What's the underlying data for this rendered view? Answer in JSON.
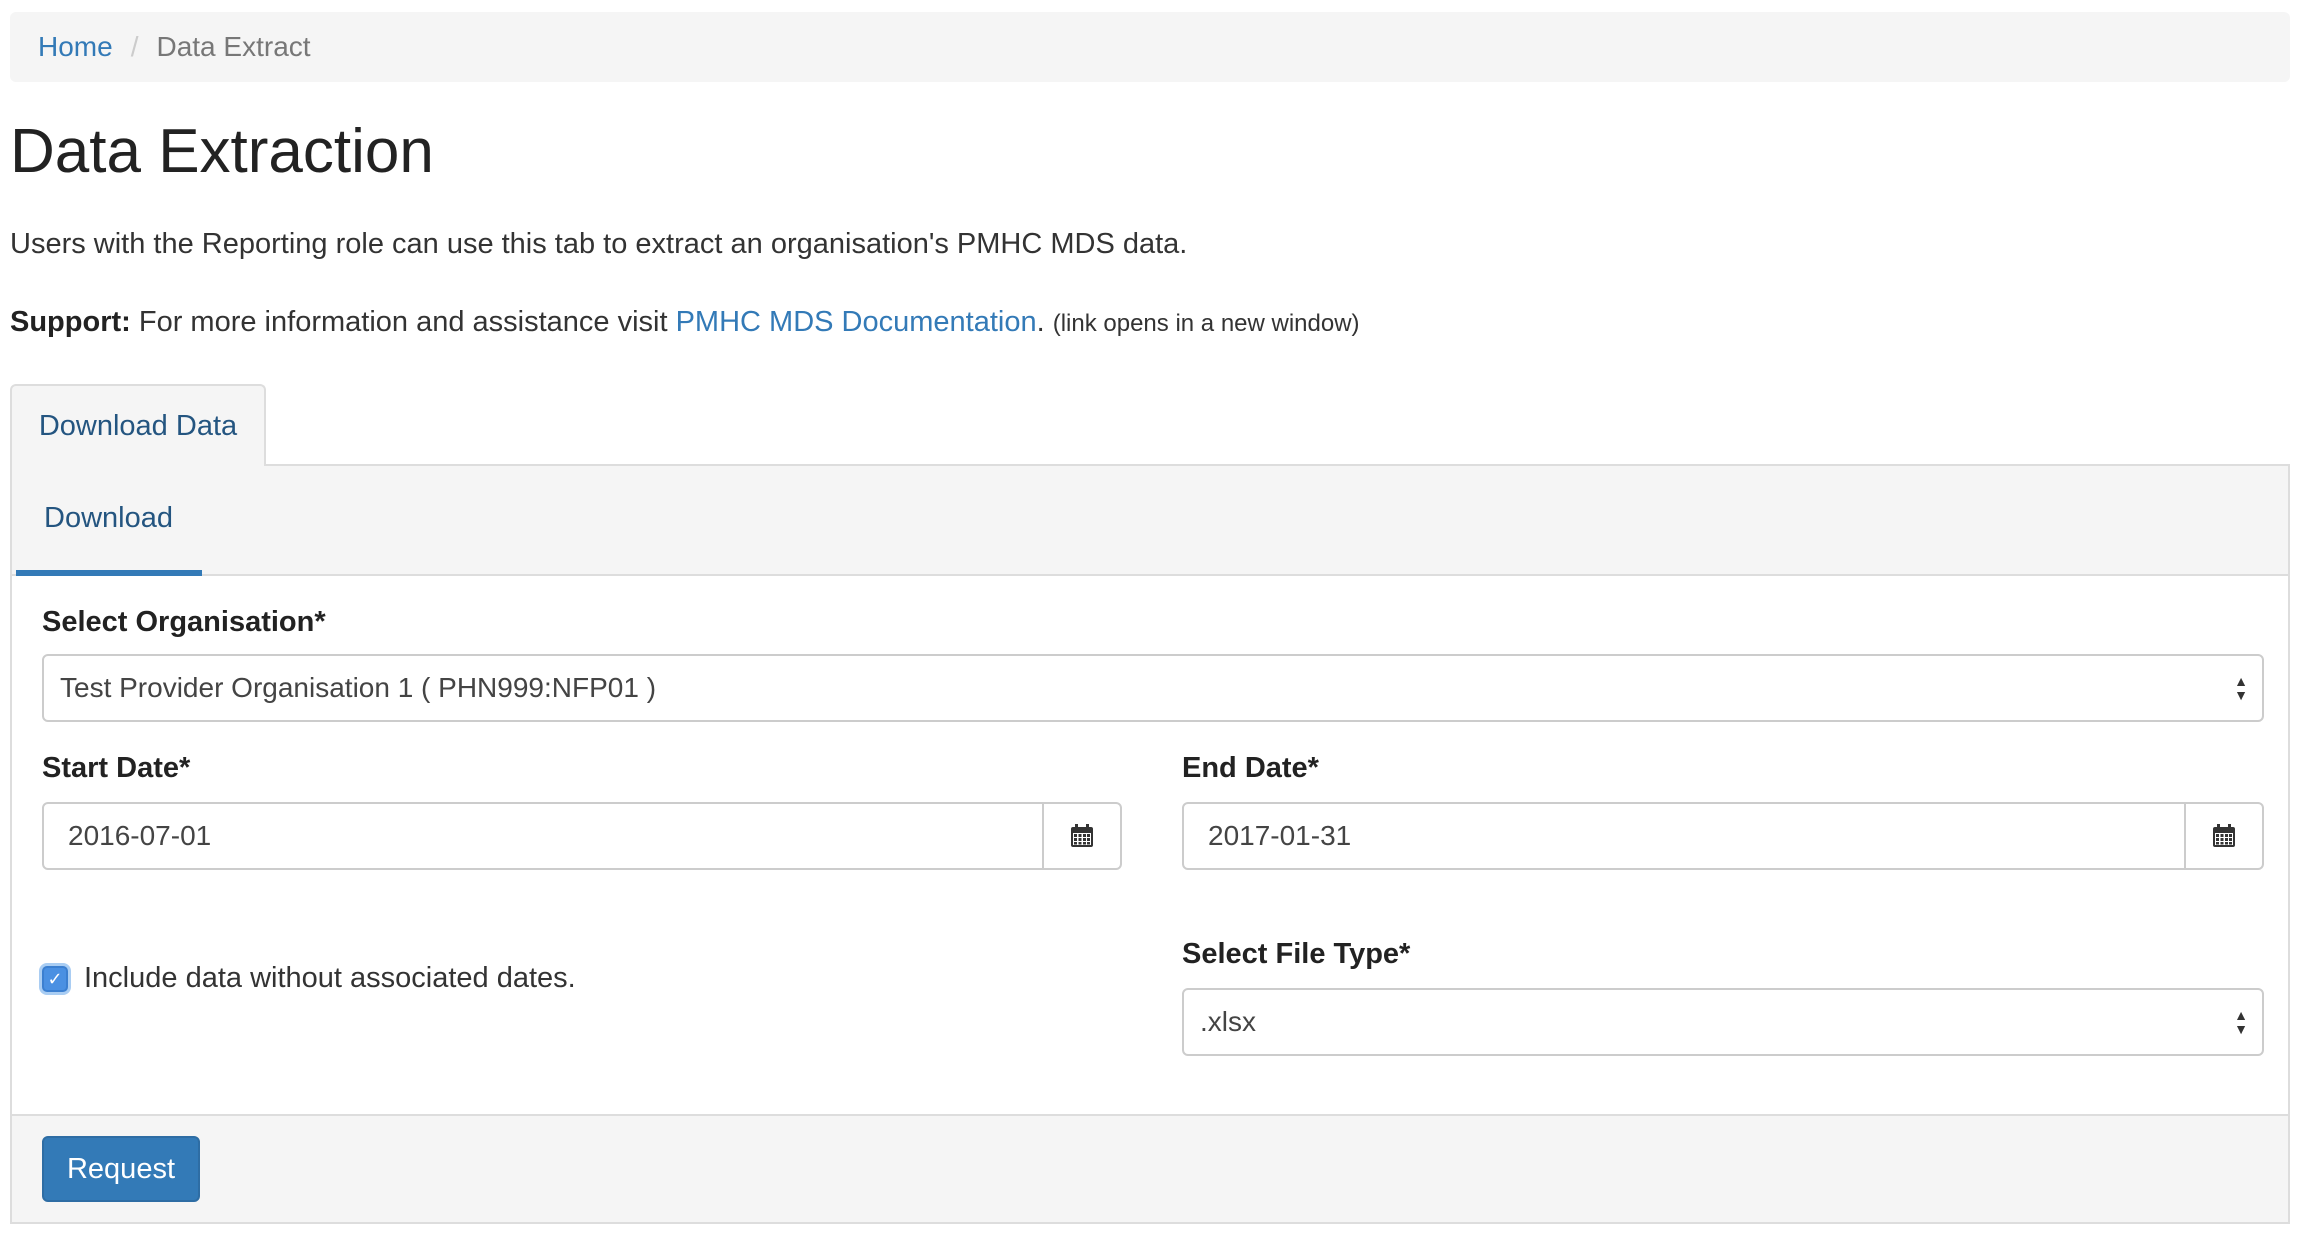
{
  "breadcrumb": {
    "home": "Home",
    "separator": "/",
    "current": "Data Extract"
  },
  "page": {
    "title": "Data Extraction",
    "intro": "Users with the Reporting role can use this tab to extract an organisation's PMHC MDS data.",
    "support_label": "Support:",
    "support_text": "For more information and assistance visit",
    "support_link": "PMHC MDS Documentation",
    "support_period": ".",
    "support_note": "(link opens in a new window)"
  },
  "tabs": {
    "outer": "Download Data",
    "inner": "Download"
  },
  "form": {
    "organisation_label": "Select Organisation*",
    "organisation_value": "Test Provider Organisation 1 ( PHN999:NFP01 )",
    "start_date_label": "Start Date*",
    "start_date_value": "2016-07-01",
    "end_date_label": "End Date*",
    "end_date_value": "2017-01-31",
    "include_undated_label": "Include data without associated dates.",
    "include_undated_checked": true,
    "file_type_label": "Select File Type*",
    "file_type_value": ".xlsx",
    "submit_label": "Request"
  },
  "icons": {
    "calendar": "calendar-icon",
    "select_arrows": "select-arrows-icon",
    "checkmark": "checkmark-icon"
  },
  "colors": {
    "link": "#337ab7",
    "primary_button": "#337ab7",
    "active_tab_underline": "#337ab7",
    "checkbox": "#4a90e2"
  }
}
